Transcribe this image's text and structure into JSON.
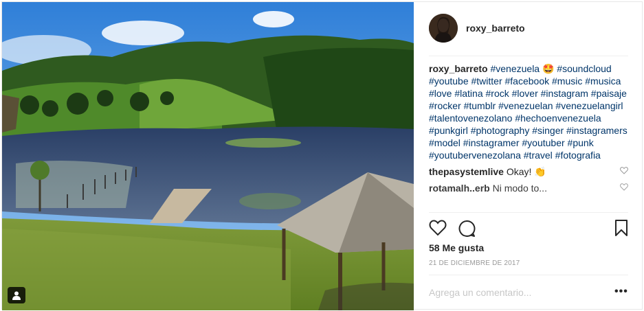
{
  "post": {
    "username": "roxy_barreto",
    "caption_user": "roxy_barreto",
    "caption_text": "#venezuela 🤩 #soundcloud #youtube #twitter #facebook #music #musica #love #latina #rock #lover #instagram #paisaje #rocker #tumblr #venezuelan #venezuelangirl #talentovenezolano #hechoenvenezuela #punkgirl #photography #singer #instagramers #model #instagramer #youtuber #punk #youtubervenezolana #travel #fotografia",
    "comments": [
      {
        "user": "thepasystemlive",
        "text": "Okay! 👏"
      },
      {
        "user": "rotamalh..erb",
        "text": "Ni modo to..."
      }
    ],
    "likes": "58 Me gusta",
    "date": "21 DE DICIEMBRE DE 2017",
    "comment_placeholder": "Agrega un comentario...",
    "more_label": "•••"
  },
  "icons": {
    "like": "heart-icon",
    "comment": "comment-icon",
    "save": "bookmark-icon",
    "user_tag": "person-icon",
    "comment_like": "small-heart-icon"
  },
  "colors": {
    "hashtag": "#003569",
    "text": "#262626",
    "muted": "#999999",
    "border": "#efefef"
  }
}
